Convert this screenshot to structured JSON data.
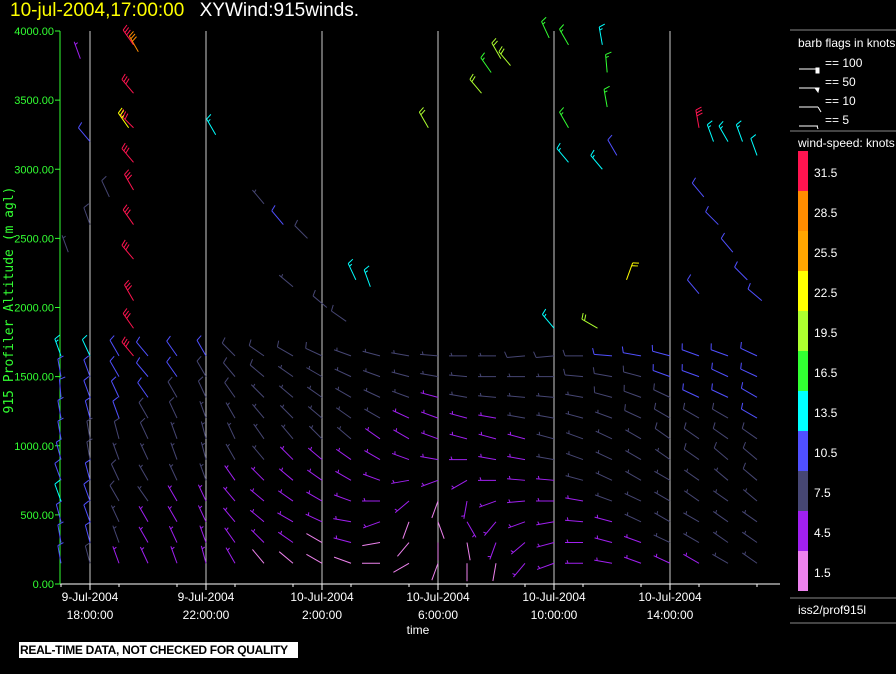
{
  "header": {
    "date": "10-jul-2004,17:00:00",
    "name": "XYWind:915winds."
  },
  "footer": {
    "warning": "REAL-TIME DATA, NOT CHECKED FOR QUALITY"
  },
  "legend": {
    "barb_title": "barb flags in knots",
    "barb_items": [
      {
        "label": "== 100",
        "knots": 100
      },
      {
        "label": "== 50",
        "knots": 50
      },
      {
        "label": "== 10",
        "knots": 10
      },
      {
        "label": "== 5",
        "knots": 5
      }
    ],
    "speed_title": "wind-speed: knots",
    "speed_bins": [
      {
        "label": "31.5",
        "color": "#ff1450"
      },
      {
        "label": "28.5",
        "color": "#ff8c00"
      },
      {
        "label": "25.5",
        "color": "#ffa500"
      },
      {
        "label": "22.5",
        "color": "#ffff00"
      },
      {
        "label": "19.5",
        "color": "#adff2f"
      },
      {
        "label": "16.5",
        "color": "#32ff32"
      },
      {
        "label": "13.5",
        "color": "#00ffff"
      },
      {
        "label": "10.5",
        "color": "#5050ff"
      },
      {
        "label": "7.5",
        "color": "#464673"
      },
      {
        "label": "4.5",
        "color": "#a020f0"
      },
      {
        "label": "1.5",
        "color": "#ee82ee"
      }
    ],
    "source": "iss2/prof915l"
  },
  "chart_data": {
    "type": "wind-barb",
    "xlabel": "time",
    "ylabel": "915 Profiler Altitude (m agl)",
    "ylim": [
      0,
      4000
    ],
    "xlim": [
      "2004-07-09 17:00",
      "2004-07-10 17:45"
    ],
    "yticks": [
      "0.00",
      "500.00",
      "1000.00",
      "1500.00",
      "2000.00",
      "2500.00",
      "3000.00",
      "3500.00",
      "4000.00"
    ],
    "xticks": [
      {
        "t": "2004-07-09 18:00",
        "l1": "9-Jul-2004",
        "l2": "18:00:00"
      },
      {
        "t": "2004-07-09 22:00",
        "l1": "9-Jul-2004",
        "l2": "22:00:00"
      },
      {
        "t": "2004-07-10 02:00",
        "l1": "10-Jul-2004",
        "l2": "2:00:00"
      },
      {
        "t": "2004-07-10 06:00",
        "l1": "10-Jul-2004",
        "l2": "6:00:00"
      },
      {
        "t": "2004-07-10 10:00",
        "l1": "10-Jul-2004",
        "l2": "10:00:00"
      },
      {
        "t": "2004-07-10 14:00",
        "l1": "10-Jul-2004",
        "l2": "14:00:00"
      }
    ],
    "grid": "vertical-major",
    "levels_m": [
      150,
      300,
      450,
      600,
      750,
      900,
      1050,
      1200,
      1350,
      1500,
      1650
    ],
    "profiles": [
      {
        "t": "2004-07-09 17:00",
        "speed": [
          9,
          10,
          11,
          12,
          11,
          10,
          9,
          9,
          10,
          11,
          13
        ],
        "dir": [
          350,
          350,
          345,
          340,
          340,
          345,
          350,
          350,
          355,
          350,
          340
        ]
      },
      {
        "t": "2004-07-09 18:00",
        "speed": [
          8,
          9,
          10,
          10,
          9,
          8,
          8,
          9,
          10,
          10,
          12
        ],
        "dir": [
          345,
          345,
          340,
          340,
          345,
          350,
          350,
          345,
          340,
          340,
          335
        ]
      },
      {
        "t": "2004-07-09 19:00",
        "speed": [
          5,
          6,
          7,
          8,
          8,
          7,
          8,
          9,
          9,
          10,
          11
        ],
        "dir": [
          340,
          340,
          335,
          330,
          335,
          340,
          345,
          340,
          335,
          330,
          330
        ]
      },
      {
        "t": "2004-07-09 20:00",
        "speed": [
          4,
          5,
          5,
          6,
          7,
          7,
          8,
          8,
          9,
          9,
          10
        ],
        "dir": [
          335,
          330,
          330,
          325,
          330,
          335,
          335,
          330,
          325,
          320,
          320
        ]
      },
      {
        "t": "2004-07-09 21:00",
        "speed": [
          3,
          4,
          5,
          5,
          6,
          7,
          7,
          8,
          8,
          9,
          9
        ],
        "dir": [
          340,
          335,
          330,
          330,
          335,
          340,
          340,
          335,
          330,
          325,
          325
        ]
      },
      {
        "t": "2004-07-09 22:00",
        "speed": [
          3,
          4,
          4,
          5,
          6,
          6,
          7,
          7,
          8,
          8,
          9
        ],
        "dir": [
          345,
          340,
          335,
          335,
          340,
          345,
          345,
          340,
          335,
          330,
          330
        ]
      },
      {
        "t": "2004-07-09 23:00",
        "speed": [
          3,
          3,
          4,
          5,
          5,
          6,
          7,
          7,
          8,
          8,
          8
        ],
        "dir": [
          330,
          325,
          320,
          320,
          325,
          330,
          335,
          330,
          325,
          320,
          315
        ]
      },
      {
        "t": "2004-07-10 00:00",
        "speed": [
          2,
          3,
          4,
          4,
          5,
          6,
          6,
          7,
          7,
          8,
          8
        ],
        "dir": [
          320,
          315,
          310,
          310,
          315,
          320,
          325,
          320,
          315,
          310,
          305
        ]
      },
      {
        "t": "2004-07-10 01:00",
        "speed": [
          2,
          3,
          3,
          4,
          5,
          5,
          6,
          7,
          7,
          7,
          8
        ],
        "dir": [
          310,
          305,
          300,
          305,
          310,
          315,
          320,
          315,
          310,
          305,
          300
        ]
      },
      {
        "t": "2004-07-10 02:00",
        "speed": [
          2,
          2,
          3,
          4,
          4,
          5,
          6,
          6,
          7,
          7,
          8
        ],
        "dir": [
          300,
          300,
          295,
          300,
          305,
          310,
          315,
          310,
          305,
          300,
          295
        ]
      },
      {
        "t": "2004-07-10 03:00",
        "speed": [
          2,
          3,
          3,
          4,
          5,
          5,
          6,
          6,
          7,
          7,
          7
        ],
        "dir": [
          290,
          285,
          280,
          290,
          300,
          305,
          310,
          305,
          300,
          295,
          290
        ]
      },
      {
        "t": "2004-07-10 04:00",
        "speed": [
          2,
          2,
          3,
          3,
          4,
          5,
          5,
          6,
          6,
          7,
          7
        ],
        "dir": [
          270,
          260,
          250,
          270,
          290,
          300,
          305,
          300,
          295,
          290,
          285
        ]
      },
      {
        "t": "2004-07-10 05:00",
        "speed": [
          1,
          2,
          2,
          3,
          3,
          4,
          5,
          5,
          6,
          6,
          7
        ],
        "dir": [
          240,
          220,
          200,
          230,
          260,
          290,
          300,
          295,
          290,
          285,
          280
        ]
      },
      {
        "t": "2004-07-10 06:00",
        "speed": [
          1,
          2,
          2,
          2,
          3,
          3,
          4,
          5,
          5,
          6,
          6
        ],
        "dir": [
          200,
          180,
          160,
          200,
          250,
          280,
          290,
          290,
          285,
          280,
          275
        ]
      },
      {
        "t": "2004-07-10 07:00",
        "speed": [
          2,
          2,
          3,
          3,
          3,
          4,
          4,
          5,
          6,
          6,
          7
        ],
        "dir": [
          180,
          170,
          150,
          190,
          240,
          270,
          285,
          285,
          280,
          275,
          270
        ]
      },
      {
        "t": "2004-07-10 08:00",
        "speed": [
          2,
          3,
          3,
          4,
          4,
          4,
          5,
          5,
          6,
          7,
          7
        ],
        "dir": [
          190,
          200,
          220,
          250,
          270,
          280,
          285,
          280,
          275,
          270,
          270
        ]
      },
      {
        "t": "2004-07-10 09:00",
        "speed": [
          3,
          3,
          4,
          4,
          5,
          5,
          5,
          6,
          6,
          7,
          8
        ],
        "dir": [
          220,
          230,
          250,
          265,
          275,
          280,
          285,
          280,
          275,
          270,
          265
        ]
      },
      {
        "t": "2004-07-10 10:00",
        "speed": [
          3,
          4,
          4,
          5,
          5,
          6,
          6,
          6,
          7,
          7,
          8
        ],
        "dir": [
          250,
          255,
          260,
          270,
          275,
          280,
          285,
          280,
          275,
          270,
          265
        ]
      },
      {
        "t": "2004-07-10 11:00",
        "speed": [
          4,
          4,
          5,
          5,
          6,
          6,
          7,
          7,
          7,
          8,
          8
        ],
        "dir": [
          270,
          270,
          275,
          280,
          285,
          290,
          290,
          285,
          280,
          275,
          270
        ]
      },
      {
        "t": "2004-07-10 12:00",
        "speed": [
          4,
          5,
          5,
          6,
          6,
          7,
          7,
          7,
          8,
          8,
          9
        ],
        "dir": [
          280,
          285,
          285,
          290,
          295,
          295,
          295,
          290,
          285,
          280,
          275
        ]
      },
      {
        "t": "2004-07-10 13:00",
        "speed": [
          5,
          5,
          6,
          6,
          7,
          7,
          7,
          8,
          8,
          8,
          9
        ],
        "dir": [
          290,
          290,
          295,
          295,
          300,
          300,
          300,
          295,
          290,
          285,
          280
        ]
      },
      {
        "t": "2004-07-10 14:00",
        "speed": [
          5,
          6,
          6,
          7,
          7,
          7,
          8,
          8,
          8,
          9,
          9
        ],
        "dir": [
          295,
          295,
          300,
          300,
          300,
          305,
          305,
          300,
          295,
          290,
          285
        ]
      },
      {
        "t": "2004-07-10 15:00",
        "speed": [
          5,
          6,
          6,
          7,
          7,
          8,
          8,
          8,
          9,
          9,
          9
        ],
        "dir": [
          300,
          300,
          300,
          305,
          305,
          305,
          305,
          300,
          295,
          290,
          290
        ]
      },
      {
        "t": "2004-07-10 16:00",
        "speed": [
          6,
          6,
          7,
          7,
          7,
          8,
          8,
          8,
          9,
          9,
          10
        ],
        "dir": [
          300,
          305,
          305,
          305,
          310,
          310,
          305,
          300,
          295,
          295,
          290
        ]
      },
      {
        "t": "2004-07-10 17:00",
        "speed": [
          6,
          6,
          7,
          7,
          8,
          8,
          8,
          9,
          9,
          10,
          10
        ],
        "dir": [
          305,
          305,
          305,
          310,
          310,
          310,
          305,
          300,
          300,
          295,
          295
        ]
      }
    ],
    "upper": [
      [
        "2004-07-09 19:30",
        1650,
        32,
        320
      ],
      [
        "2004-07-09 19:30",
        1850,
        31,
        325
      ],
      [
        "2004-07-09 19:30",
        2050,
        32,
        330
      ],
      [
        "2004-07-09 19:30",
        2350,
        31,
        320
      ],
      [
        "2004-07-09 19:30",
        2600,
        32,
        325
      ],
      [
        "2004-07-09 19:30",
        2850,
        31,
        330
      ],
      [
        "2004-07-09 19:30",
        3050,
        32,
        320
      ],
      [
        "2004-07-09 19:30",
        3300,
        31,
        315
      ],
      [
        "2004-07-09 19:30",
        3550,
        32,
        320
      ],
      [
        "2004-07-09 19:30",
        3900,
        31,
        325
      ],
      [
        "2004-07-09 19:40",
        3850,
        28,
        330
      ],
      [
        "2004-07-09 19:20",
        3300,
        23,
        325
      ],
      [
        "2004-07-09 22:20",
        3250,
        13,
        330
      ],
      [
        "2004-07-09 18:00",
        3200,
        10,
        320
      ],
      [
        "2004-07-09 17:40",
        3800,
        5,
        340
      ],
      [
        "2004-07-10 03:40",
        2150,
        13,
        340
      ],
      [
        "2004-07-10 03:10",
        2200,
        13,
        335
      ],
      [
        "2004-07-10 05:40",
        3300,
        20,
        330
      ],
      [
        "2004-07-10 07:30",
        3550,
        20,
        320
      ],
      [
        "2004-07-10 07:50",
        3700,
        17,
        325
      ],
      [
        "2004-07-10 08:10",
        3800,
        19,
        330
      ],
      [
        "2004-07-10 08:30",
        3750,
        20,
        320
      ],
      [
        "2004-07-10 09:50",
        3950,
        17,
        335
      ],
      [
        "2004-07-10 10:30",
        3900,
        15,
        330
      ],
      [
        "2004-07-10 11:40",
        3900,
        13,
        350
      ],
      [
        "2004-07-10 11:50",
        3700,
        17,
        355
      ],
      [
        "2004-07-10 11:50",
        3450,
        17,
        350
      ],
      [
        "2004-07-10 10:30",
        3300,
        16,
        330
      ],
      [
        "2004-07-10 10:30",
        3050,
        14,
        320
      ],
      [
        "2004-07-10 11:40",
        3000,
        14,
        320
      ],
      [
        "2004-07-10 12:10",
        3100,
        11,
        330
      ],
      [
        "2004-07-10 12:30",
        2200,
        22,
        20
      ],
      [
        "2004-07-10 10:00",
        1850,
        13,
        320
      ],
      [
        "2004-07-10 11:30",
        1850,
        19,
        300
      ],
      [
        "2004-07-10 15:00",
        3300,
        31,
        350
      ],
      [
        "2004-07-10 15:30",
        3200,
        13,
        340
      ],
      [
        "2004-07-10 16:00",
        3200,
        13,
        330
      ],
      [
        "2004-07-10 16:30",
        3200,
        13,
        340
      ],
      [
        "2004-07-10 17:00",
        3100,
        12,
        340
      ],
      [
        "2004-07-10 15:10",
        2800,
        11,
        320
      ],
      [
        "2004-07-10 15:40",
        2600,
        11,
        315
      ],
      [
        "2004-07-10 16:10",
        2400,
        11,
        320
      ],
      [
        "2004-07-10 16:40",
        2200,
        10,
        315
      ],
      [
        "2004-07-10 17:10",
        2050,
        10,
        310
      ],
      [
        "2004-07-10 15:00",
        2100,
        10,
        320
      ],
      [
        "2004-07-09 17:15",
        2400,
        7,
        340
      ],
      [
        "2004-07-09 18:00",
        2600,
        8,
        340
      ],
      [
        "2004-07-09 18:40",
        2800,
        8,
        335
      ],
      [
        "2004-07-10 00:40",
        2600,
        9,
        320
      ],
      [
        "2004-07-10 01:30",
        2500,
        8,
        315
      ],
      [
        "2004-07-10 02:10",
        2000,
        8,
        310
      ],
      [
        "2004-07-10 02:50",
        1900,
        8,
        305
      ],
      [
        "2004-07-10 00:00",
        2750,
        7,
        320
      ],
      [
        "2004-07-10 01:00",
        2150,
        7,
        310
      ]
    ]
  }
}
